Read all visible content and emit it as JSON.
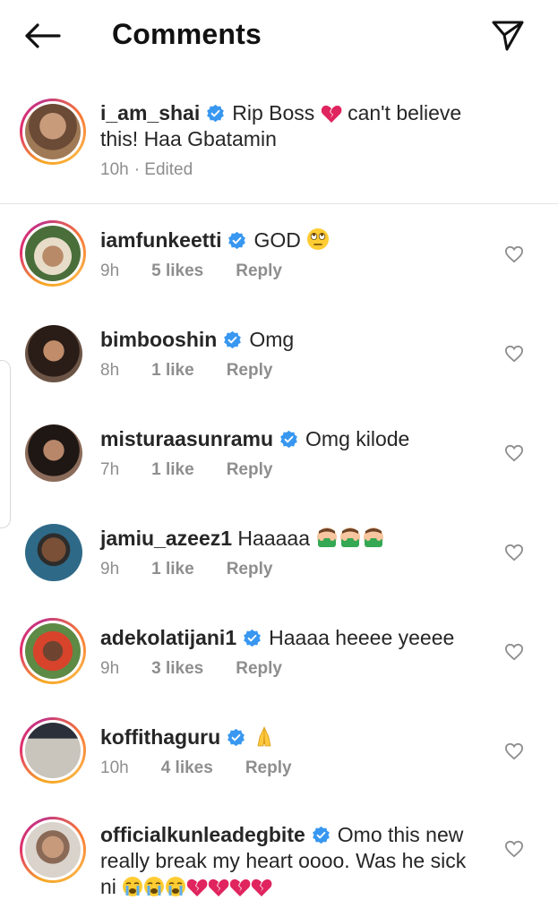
{
  "header": {
    "title": "Comments"
  },
  "caption": {
    "username": "i_am_shai",
    "text_1": "Rip Boss",
    "text_2": "can't believe",
    "text_3": "this! Haa Gbatamin",
    "time": "10h",
    "edited": "· Edited"
  },
  "comments": [
    {
      "username": "iamfunkeetti",
      "text": "GOD",
      "emoji": "eye-roll",
      "time": "9h",
      "likes": "5 likes",
      "reply": "Reply"
    },
    {
      "username": "bimbooshin",
      "text": "Omg",
      "time": "8h",
      "likes": "1 like",
      "reply": "Reply"
    },
    {
      "username": "misturaasunramu",
      "text": "Omg kilode",
      "time": "7h",
      "likes": "1 like",
      "reply": "Reply"
    },
    {
      "username": "jamiu_azeez1",
      "text": "Haaaaa",
      "emoji": "face-palm x3",
      "time": "9h",
      "likes": "1 like",
      "reply": "Reply"
    },
    {
      "username": "adekolatijani1",
      "text": "Haaaa heeee yeeee",
      "time": "9h",
      "likes": "3 likes",
      "reply": "Reply"
    },
    {
      "username": "koffithaguru",
      "text": "",
      "emoji": "folded-hands",
      "time": "10h",
      "likes": "4 likes",
      "reply": "Reply"
    },
    {
      "username": "officialkunleadegbite",
      "text_1": "Omo this new",
      "text_2": "really break my heart oooo. Was he sick",
      "text_3": "ni",
      "emoji": "crying x3, broken-heart x4"
    }
  ],
  "colors": {
    "verified": "#3897f0",
    "muted": "#8e8e8e",
    "broken_heart": "#e0245e"
  }
}
